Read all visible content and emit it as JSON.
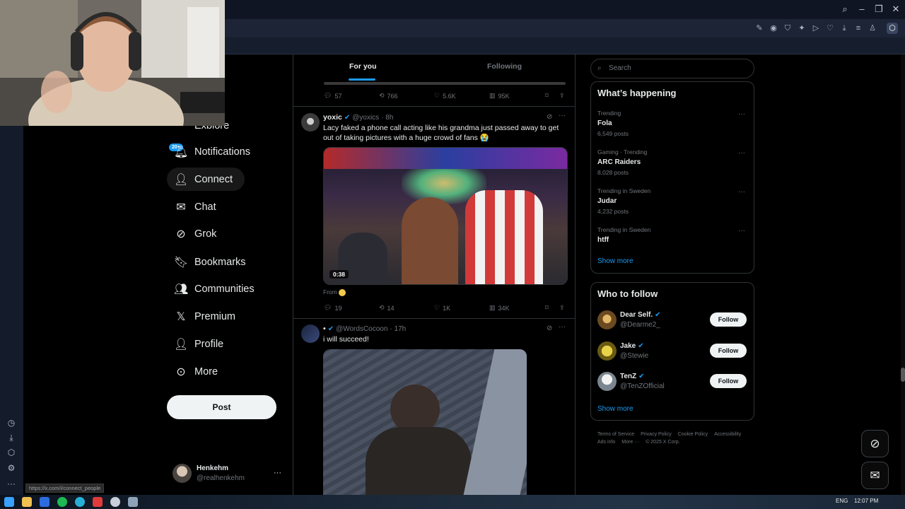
{
  "browser": {
    "url_hint": "https://x.com/i/connect_people",
    "taskbar_lang": "ENG",
    "clock": "12:07 PM"
  },
  "nav": {
    "explore_partial": "Explore",
    "notifications_badge": "20+",
    "items": [
      {
        "label": "Notifications",
        "icon": "bell-icon"
      },
      {
        "label": "Connect",
        "icon": "person-add-icon"
      },
      {
        "label": "Chat",
        "icon": "mail-icon"
      },
      {
        "label": "Grok",
        "icon": "grok-icon"
      },
      {
        "label": "Bookmarks",
        "icon": "bookmark-icon"
      },
      {
        "label": "Communities",
        "icon": "communities-icon"
      },
      {
        "label": "Premium",
        "icon": "x-logo-icon"
      },
      {
        "label": "Profile",
        "icon": "person-icon"
      },
      {
        "label": "More",
        "icon": "more-circle-icon"
      }
    ],
    "post_label": "Post",
    "account": {
      "name": "Henkehm",
      "handle": "@realhenkehm"
    }
  },
  "feed": {
    "tabs": [
      "For you",
      "Following"
    ],
    "first_stats": {
      "replies": "57",
      "reposts": "766",
      "likes": "5.6K",
      "views": "95K"
    },
    "tweet1": {
      "name": "yoxic",
      "handle": "@yoxics",
      "time": "· 8h",
      "text": "Lacy faked a phone call acting like his grandma just passed away to get out of taking pictures with a huge crowd of fans 😭",
      "video_duration": "0:38",
      "from_label": "From",
      "stats": {
        "replies": "19",
        "reposts": "14",
        "likes": "1K",
        "views": "34K"
      }
    },
    "tweet2": {
      "name": "•",
      "handle": "@WordsCocoon",
      "time": "· 17h",
      "text": "i will succeed!"
    }
  },
  "sidebar": {
    "search_placeholder": "Search",
    "happening_title": "What’s happening",
    "trends": [
      {
        "meta": "Trending",
        "name": "Fola",
        "posts": "6,549 posts"
      },
      {
        "meta": "Gaming · Trending",
        "name": "ARC Raiders",
        "posts": "8,028 posts"
      },
      {
        "meta": "Trending in Sweden",
        "name": "Judar",
        "posts": "4,232 posts"
      },
      {
        "meta": "Trending in Sweden",
        "name": "htff",
        "posts": ""
      }
    ],
    "show_more": "Show more",
    "follow_title": "Who to follow",
    "follow": [
      {
        "name": "Dear Self.",
        "handle": "@Dearme2_",
        "btn": "Follow"
      },
      {
        "name": "Jake",
        "handle": "@Stewie",
        "btn": "Follow"
      },
      {
        "name": "TenZ",
        "handle": "@TenZOfficial",
        "btn": "Follow"
      }
    ],
    "show_more_2": "Show more",
    "footer": [
      "Terms of Service",
      "Privacy Policy",
      "Cookie Policy",
      "Accessibility",
      "Ads info",
      "More ···",
      "© 2025 X Corp."
    ]
  }
}
